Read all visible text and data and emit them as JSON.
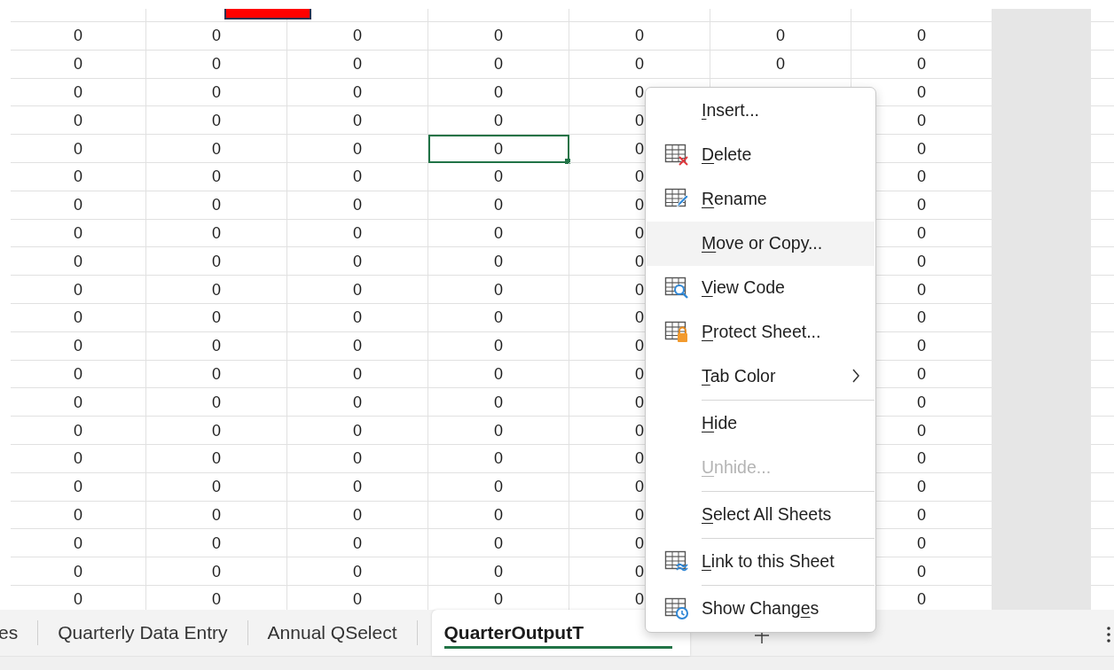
{
  "sheet": {
    "rows": [
      {
        "cells": [
          {
            "text": "0",
            "selected": false
          },
          {
            "text": "0",
            "selected": false
          },
          {
            "text": "0",
            "selected": false
          },
          {
            "text": "0",
            "selected": false
          },
          {
            "text": "0",
            "selected": false
          },
          {
            "text": "0",
            "selected": false
          },
          {
            "text": "0",
            "selected": false
          }
        ]
      },
      {
        "cells": [
          {
            "text": "0",
            "selected": false
          },
          {
            "text": "0",
            "selected": false
          },
          {
            "text": "0",
            "selected": false
          },
          {
            "text": "0",
            "selected": false
          },
          {
            "text": "0",
            "selected": false
          },
          {
            "text": "0",
            "selected": false
          },
          {
            "text": "0",
            "selected": false
          }
        ]
      },
      {
        "cells": [
          {
            "text": "0",
            "selected": false
          },
          {
            "text": "0",
            "selected": false
          },
          {
            "text": "0",
            "selected": false
          },
          {
            "text": "0",
            "selected": false
          },
          {
            "text": "0",
            "selected": false
          },
          null,
          {
            "text": "0",
            "selected": false
          }
        ]
      },
      {
        "cells": [
          {
            "text": "0",
            "selected": false
          },
          {
            "text": "0",
            "selected": false
          },
          {
            "text": "0",
            "selected": false
          },
          {
            "text": "0",
            "selected": false
          },
          {
            "text": "0",
            "selected": false
          },
          null,
          {
            "text": "0",
            "selected": false
          }
        ]
      },
      {
        "cells": [
          {
            "text": "0",
            "selected": false
          },
          {
            "text": "0",
            "selected": false
          },
          {
            "text": "0",
            "selected": false
          },
          {
            "text": "0",
            "selected": true
          },
          {
            "text": "0",
            "selected": false
          },
          null,
          {
            "text": "0",
            "selected": false
          }
        ]
      },
      {
        "cells": [
          {
            "text": "0",
            "selected": false
          },
          {
            "text": "0",
            "selected": false
          },
          {
            "text": "0",
            "selected": false
          },
          {
            "text": "0",
            "selected": false
          },
          {
            "text": "0",
            "selected": false
          },
          null,
          {
            "text": "0",
            "selected": false
          }
        ]
      },
      {
        "cells": [
          {
            "text": "0",
            "selected": false
          },
          {
            "text": "0",
            "selected": false
          },
          {
            "text": "0",
            "selected": false
          },
          {
            "text": "0",
            "selected": false
          },
          {
            "text": "0",
            "selected": false
          },
          null,
          {
            "text": "0",
            "selected": false
          }
        ]
      },
      {
        "cells": [
          {
            "text": "0",
            "selected": false
          },
          {
            "text": "0",
            "selected": false
          },
          {
            "text": "0",
            "selected": false
          },
          {
            "text": "0",
            "selected": false
          },
          {
            "text": "0",
            "selected": false
          },
          null,
          {
            "text": "0",
            "selected": false
          }
        ]
      },
      {
        "cells": [
          {
            "text": "0",
            "selected": false
          },
          {
            "text": "0",
            "selected": false
          },
          {
            "text": "0",
            "selected": false
          },
          {
            "text": "0",
            "selected": false
          },
          {
            "text": "0",
            "selected": false
          },
          null,
          {
            "text": "0",
            "selected": false
          }
        ]
      },
      {
        "cells": [
          {
            "text": "0",
            "selected": false
          },
          {
            "text": "0",
            "selected": false
          },
          {
            "text": "0",
            "selected": false
          },
          {
            "text": "0",
            "selected": false
          },
          {
            "text": "0",
            "selected": false
          },
          null,
          {
            "text": "0",
            "selected": false
          }
        ]
      },
      {
        "cells": [
          {
            "text": "0",
            "selected": false
          },
          {
            "text": "0",
            "selected": false
          },
          {
            "text": "0",
            "selected": false
          },
          {
            "text": "0",
            "selected": false
          },
          {
            "text": "0",
            "selected": false
          },
          null,
          {
            "text": "0",
            "selected": false
          }
        ]
      },
      {
        "cells": [
          {
            "text": "0",
            "selected": false
          },
          {
            "text": "0",
            "selected": false
          },
          {
            "text": "0",
            "selected": false
          },
          {
            "text": "0",
            "selected": false
          },
          {
            "text": "0",
            "selected": false
          },
          null,
          {
            "text": "0",
            "selected": false
          }
        ]
      },
      {
        "cells": [
          {
            "text": "0",
            "selected": false
          },
          {
            "text": "0",
            "selected": false
          },
          {
            "text": "0",
            "selected": false
          },
          {
            "text": "0",
            "selected": false
          },
          {
            "text": "0",
            "selected": false
          },
          null,
          {
            "text": "0",
            "selected": false
          }
        ]
      },
      {
        "cells": [
          {
            "text": "0",
            "selected": false
          },
          {
            "text": "0",
            "selected": false
          },
          {
            "text": "0",
            "selected": false
          },
          {
            "text": "0",
            "selected": false
          },
          {
            "text": "0",
            "selected": false
          },
          null,
          {
            "text": "0",
            "selected": false
          }
        ]
      },
      {
        "cells": [
          {
            "text": "0",
            "selected": false
          },
          {
            "text": "0",
            "selected": false
          },
          {
            "text": "0",
            "selected": false
          },
          {
            "text": "0",
            "selected": false
          },
          {
            "text": "0",
            "selected": false
          },
          null,
          {
            "text": "0",
            "selected": false
          }
        ]
      },
      {
        "cells": [
          {
            "text": "0",
            "selected": false
          },
          {
            "text": "0",
            "selected": false
          },
          {
            "text": "0",
            "selected": false
          },
          {
            "text": "0",
            "selected": false
          },
          {
            "text": "0",
            "selected": false
          },
          null,
          {
            "text": "0",
            "selected": false
          }
        ]
      },
      {
        "cells": [
          {
            "text": "0",
            "selected": false
          },
          {
            "text": "0",
            "selected": false
          },
          {
            "text": "0",
            "selected": false
          },
          {
            "text": "0",
            "selected": false
          },
          {
            "text": "0",
            "selected": false
          },
          null,
          {
            "text": "0",
            "selected": false
          }
        ]
      },
      {
        "cells": [
          {
            "text": "0",
            "selected": false
          },
          {
            "text": "0",
            "selected": false
          },
          {
            "text": "0",
            "selected": false
          },
          {
            "text": "0",
            "selected": false
          },
          {
            "text": "0",
            "selected": false
          },
          null,
          {
            "text": "0",
            "selected": false
          }
        ]
      },
      {
        "cells": [
          {
            "text": "0",
            "selected": false
          },
          {
            "text": "0",
            "selected": false
          },
          {
            "text": "0",
            "selected": false
          },
          {
            "text": "0",
            "selected": false
          },
          {
            "text": "0",
            "selected": false
          },
          null,
          {
            "text": "0",
            "selected": false
          }
        ]
      },
      {
        "cells": [
          {
            "text": "0",
            "selected": false
          },
          {
            "text": "0",
            "selected": false
          },
          {
            "text": "0",
            "selected": false
          },
          {
            "text": "0",
            "selected": false
          },
          {
            "text": "0",
            "selected": false
          },
          null,
          {
            "text": "0",
            "selected": false
          }
        ]
      },
      {
        "cells": [
          {
            "text": "0",
            "selected": false
          },
          {
            "text": "0",
            "selected": false
          },
          {
            "text": "0",
            "selected": false
          },
          {
            "text": "0",
            "selected": false
          },
          {
            "text": "0",
            "selected": false
          },
          null,
          {
            "text": "0",
            "selected": false
          }
        ]
      }
    ]
  },
  "sheet_tabs": [
    {
      "label": "es",
      "selected": false
    },
    {
      "label": "Quarterly Data Entry",
      "selected": false
    },
    {
      "label": "Annual QSelect",
      "selected": false
    },
    {
      "label": "QuarterOutputT",
      "selected": true
    }
  ],
  "context_menu": [
    {
      "kind": "plain",
      "label": "Insert...",
      "selected": false,
      "disabled": false,
      "submenu": false
    },
    {
      "kind": "delete",
      "label": "Delete",
      "selected": false,
      "disabled": false,
      "submenu": false
    },
    {
      "kind": "rename",
      "label": "Rename",
      "selected": false,
      "disabled": false,
      "submenu": false
    },
    {
      "kind": "plain",
      "label": "Move or Copy...",
      "selected": true,
      "disabled": false,
      "submenu": false
    },
    {
      "kind": "view-code",
      "label": "View Code",
      "selected": false,
      "disabled": false,
      "submenu": false
    },
    {
      "kind": "protect",
      "label": "Protect Sheet...",
      "selected": false,
      "disabled": false,
      "submenu": false
    },
    {
      "kind": "plain",
      "label": "Tab Color",
      "selected": false,
      "disabled": false,
      "submenu": true
    },
    {
      "kind": "separator"
    },
    {
      "kind": "plain",
      "label": "Hide",
      "selected": false,
      "disabled": false,
      "submenu": false
    },
    {
      "kind": "plain",
      "label": "Unhide...",
      "selected": false,
      "disabled": true,
      "submenu": false
    },
    {
      "kind": "separator"
    },
    {
      "kind": "plain",
      "label": "Select All Sheets",
      "selected": false,
      "disabled": false,
      "submenu": false
    },
    {
      "kind": "separator"
    },
    {
      "kind": "link",
      "label": "Link to this Sheet",
      "selected": false,
      "disabled": false,
      "submenu": false
    },
    {
      "kind": "separator"
    },
    {
      "kind": "show-changes",
      "label": "Show Changes",
      "selected": false,
      "disabled": false,
      "submenu": false
    }
  ]
}
